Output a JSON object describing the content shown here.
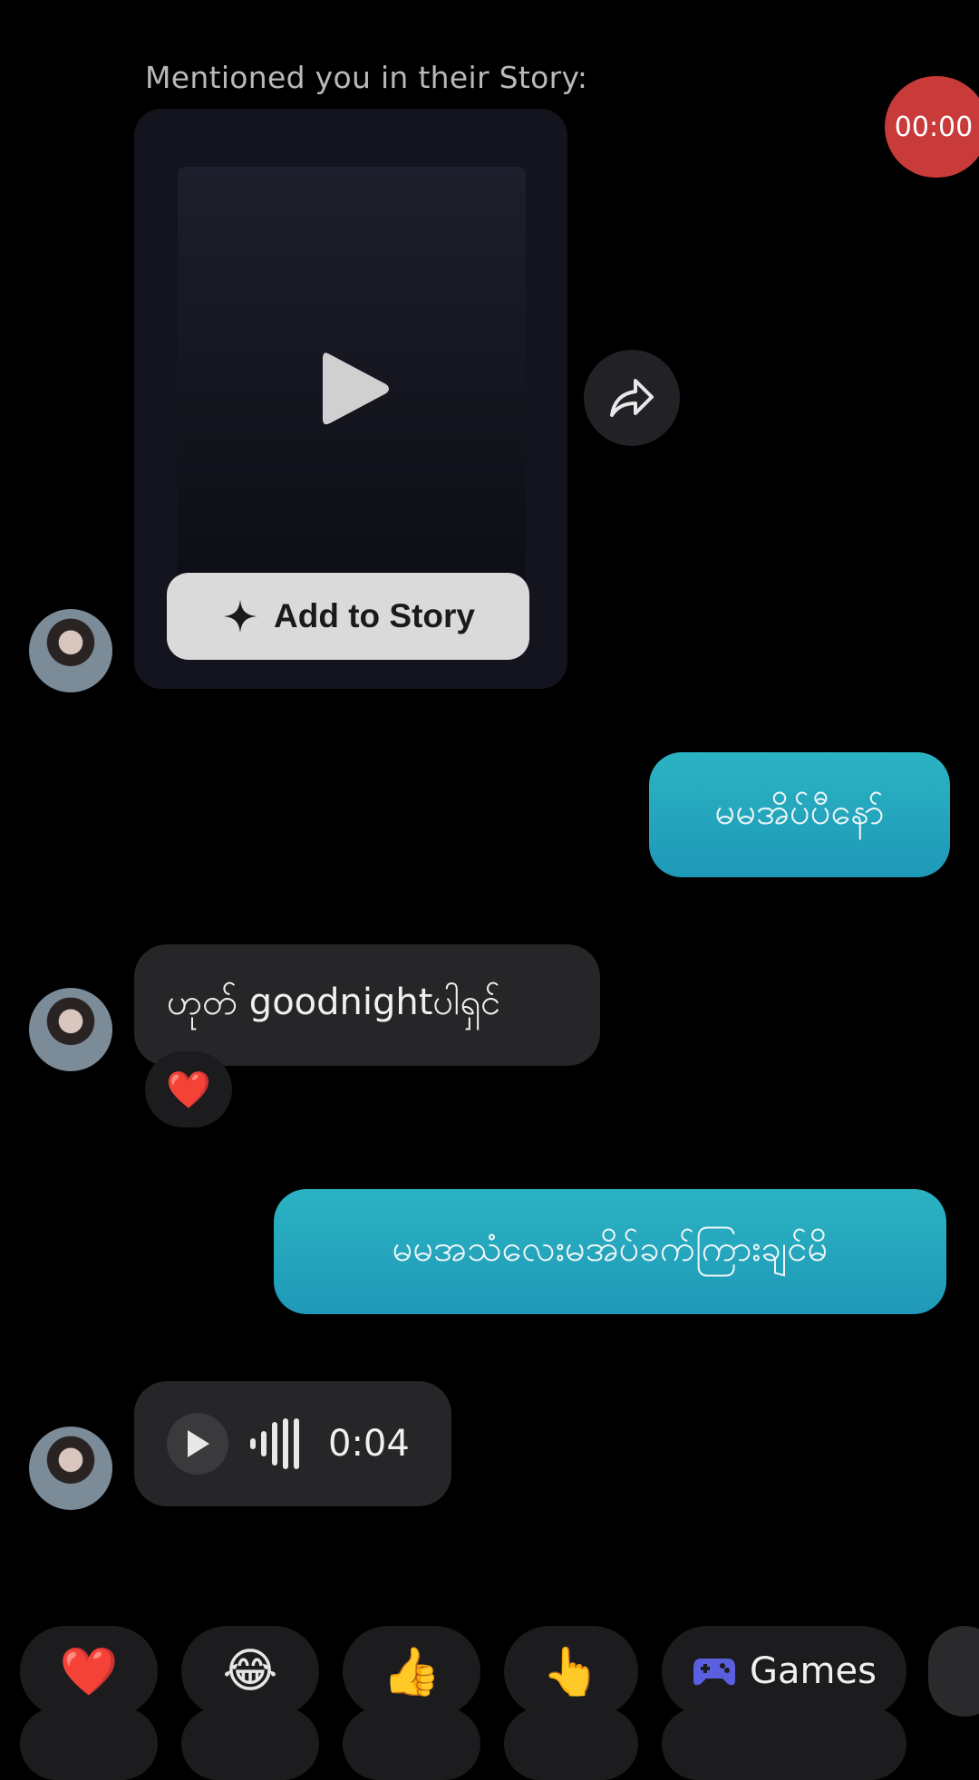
{
  "story_mention": {
    "header": "Mentioned you in their Story:",
    "add_to_story_label": "Add to Story"
  },
  "recording_badge": "00:00",
  "messages": {
    "outgoing_1": "မမအိပ်ပီနော်",
    "incoming_1": "ဟုတ် goodnightပါရှင်",
    "incoming_1_reaction": "❤️",
    "outgoing_2": "မမအသံလေးမအိပ်ခက်ကြားချင်မိ",
    "voice_note_duration": "0:04"
  },
  "quick_replies": [
    {
      "emoji": "❤️"
    },
    {
      "emoji": "😂"
    },
    {
      "emoji": "👍"
    },
    {
      "emoji": "👆"
    },
    {
      "label": "Games",
      "icon": "gamepad-icon"
    }
  ],
  "colors": {
    "outgoing_bubble": "#24a7bd",
    "incoming_bubble": "#262628",
    "recording_badge": "#c93a3a",
    "background": "#000000"
  }
}
